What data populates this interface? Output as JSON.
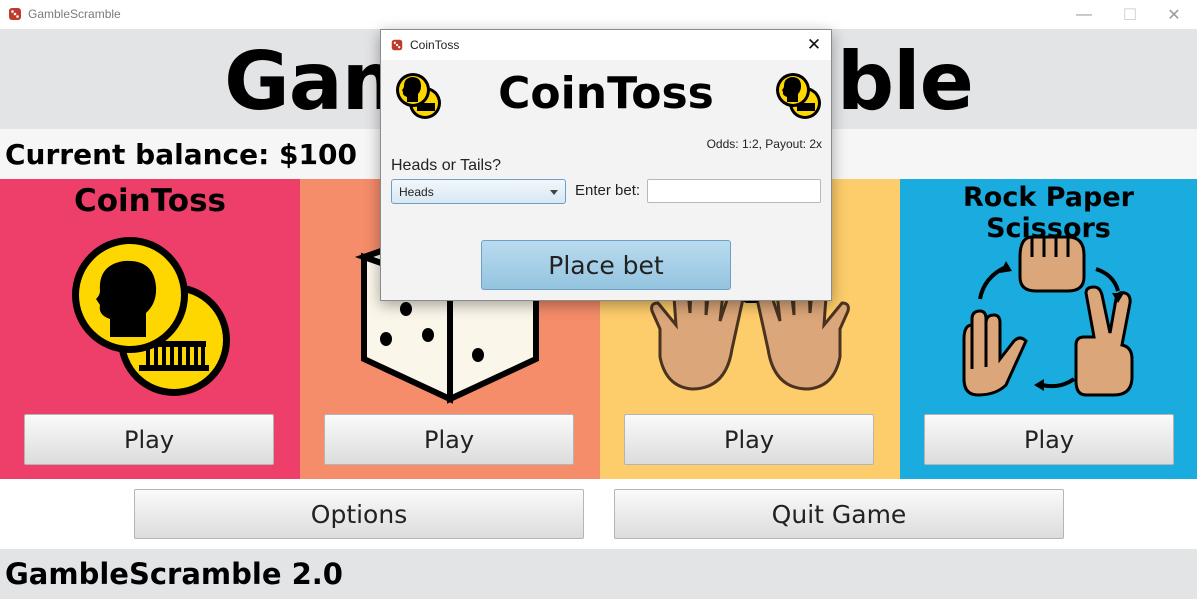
{
  "window": {
    "title": "GambleScramble",
    "controls": {
      "minimize": "—",
      "maximize": "☐",
      "close": "✕"
    }
  },
  "header": {
    "title": "GambleScramble"
  },
  "balance": {
    "text": "Current balance: $100"
  },
  "games": [
    {
      "title": "CoinToss",
      "play_label": "Play",
      "color": "#ee3f6a"
    },
    {
      "title": "",
      "play_label": "Play",
      "color": "#f58c6a"
    },
    {
      "title": "",
      "play_label": "Play",
      "color": "#fecd6b"
    },
    {
      "title": "Rock Paper Scissors",
      "play_label": "Play",
      "color": "#1aabdf"
    }
  ],
  "buttons": {
    "options": "Options",
    "quit": "Quit Game"
  },
  "footer": {
    "version": "GambleScramble 2.0"
  },
  "dialog": {
    "title": "CoinToss",
    "heading": "CoinToss",
    "close_glyph": "✕",
    "odds": "Odds: 1:2, Payout: 2x",
    "heads_tails_label": "Heads or Tails?",
    "selected_option": "Heads",
    "bet_label": "Enter bet:",
    "bet_value": "",
    "place_bet_label": "Place bet"
  },
  "colors": {
    "coin_yellow": "#ffd700",
    "skin": "#dba679",
    "dice_cream": "#fbf6ea",
    "header_gray": "#e3e4e6"
  }
}
